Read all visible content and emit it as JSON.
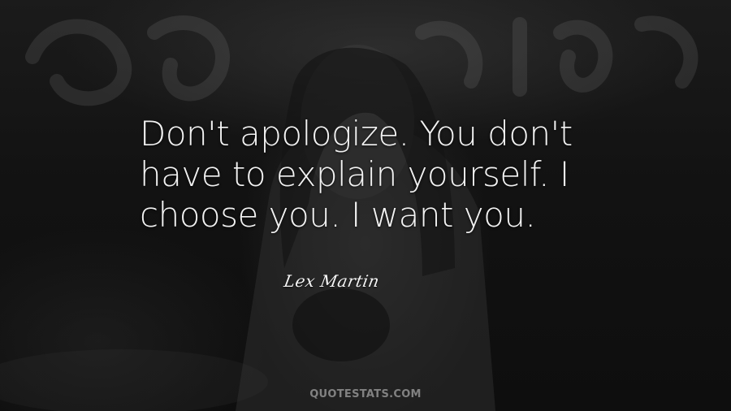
{
  "quote": {
    "lines": [
      "Don't apologize. You don't",
      "have to explain yourself. I",
      "choose you. I want you."
    ]
  },
  "author": "Lex Martin",
  "watermark": "QUOTESTATS.COM",
  "colors": {
    "background": "#121212",
    "text": "#f2f2f2"
  }
}
